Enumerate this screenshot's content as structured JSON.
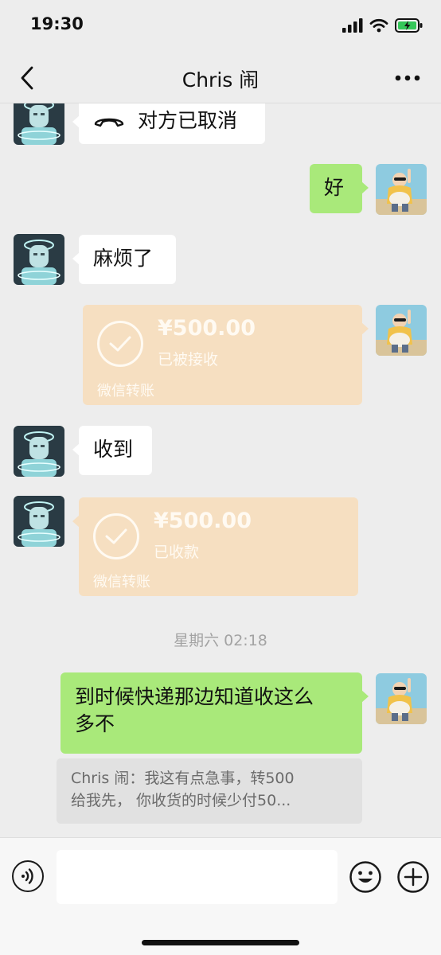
{
  "status_bar": {
    "time": "19:30"
  },
  "nav": {
    "title": "Chris 闹"
  },
  "messages": [
    {
      "id": "m1",
      "side": "left",
      "icon": "phone-hangup-icon",
      "text": "对方已取消"
    },
    {
      "id": "m2",
      "side": "right",
      "text": "好"
    },
    {
      "id": "m3",
      "side": "left",
      "text": "麻烦了"
    },
    {
      "id": "m4",
      "side": "right",
      "type": "transfer",
      "amount": "¥500.00",
      "status": "已被接收",
      "footer": "微信转账"
    },
    {
      "id": "m5",
      "side": "left",
      "text": "收到"
    },
    {
      "id": "m6",
      "side": "left",
      "type": "transfer",
      "amount": "¥500.00",
      "status": "已收款",
      "footer": "微信转账"
    },
    {
      "id": "m7",
      "type": "timestamp",
      "text": "星期六 02:18"
    },
    {
      "id": "m8",
      "side": "right",
      "lines": [
        "到时候快递那边知道收这么",
        "多不"
      ]
    },
    {
      "id": "m9",
      "type": "quote",
      "lines": [
        "Chris 闹：我这有点急事，转500",
        "给我先， 你收货的时候少付50..."
      ]
    }
  ],
  "colors": {
    "background": "#ededed",
    "sent_bubble": "#a9e97a",
    "received_bubble": "#ffffff",
    "transfer_card": "#f6dfc1",
    "timestamp_text": "#a3a3a3"
  },
  "input_bar": {
    "voice_icon": "voice-icon",
    "emoji_icon": "emoji-icon",
    "plus_icon": "plus-icon"
  }
}
